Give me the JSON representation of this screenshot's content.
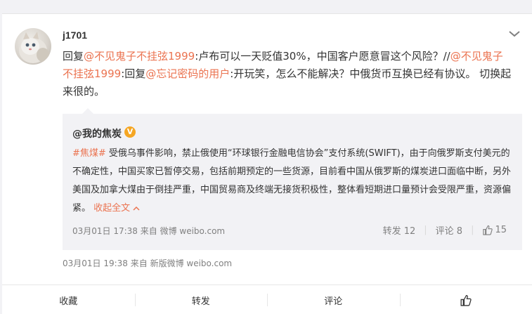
{
  "post": {
    "username": "j1701",
    "text": {
      "p1": "回复",
      "mention1": "@不见鬼子不挂弦1999",
      "p2": ":卢布可以一天贬值30%，中国客户愿意冒这个风险？//",
      "mention2": "@不见鬼子不挂弦1999",
      "p3": ":回复",
      "mention3": "@忘记密码的用户",
      "p4": ":开玩笑，怎么不能解决？中俄货币互换已经有协议。 切换起来很的。"
    },
    "meta": "03月01日 19:38 来自 新版微博 weibo.com"
  },
  "repost": {
    "author": "@我的焦炭",
    "verified_badge": "V",
    "topic": "#焦煤#",
    "body": " 受俄乌事件影响，禁止俄使用“环球银行金融电信协会”支付系统(SWIFT)，由于向俄罗斯支付美元的不确定性，中国买家已暂停交易，包括前期预定的一些货源，目前看中国从俄罗斯的煤炭进口面临中断，另外美国及加拿大煤由于倒挂严重，中国贸易商及终端无接货积极性，整体看短期进口量预计会受限严重，资源偏紧。",
    "collapse_label": "收起全文",
    "meta": "03月01日 17:38 来自 微博 weibo.com",
    "forward": "转发 12",
    "comment": "评论 8",
    "likes": "15"
  },
  "footer": {
    "favorite": "收藏",
    "forward": "转发",
    "comment": "评论"
  },
  "icons": {
    "chevron": "chevron-down-icon",
    "like": "thumbs-up-icon",
    "collapse": "chevron-up-icon",
    "verified": "verified-badge-icon"
  },
  "colors": {
    "link": "#eb7350",
    "meta": "#808080",
    "verified": "#f5a623",
    "background": "#f2f2f5"
  }
}
